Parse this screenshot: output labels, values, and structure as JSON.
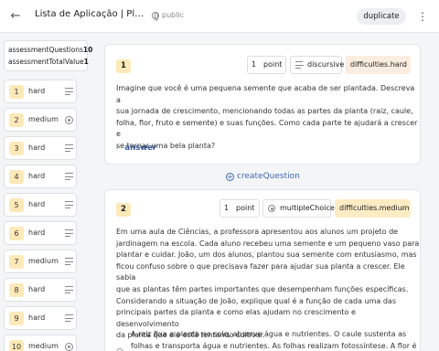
{
  "header": {
    "title": "Lista de Aplicação | Plantas...",
    "visibility": "public",
    "duplicate_label": "duplicate"
  },
  "assessment": {
    "questions_label": "assessmentQuestions",
    "questions_value": "10",
    "total_label": "assessmentTotalValue",
    "total_value": "1"
  },
  "sidebar": {
    "items": [
      {
        "num": "1",
        "difficulty": "hard",
        "type": "discursive"
      },
      {
        "num": "2",
        "difficulty": "medium",
        "type": "multipleChoice"
      },
      {
        "num": "3",
        "difficulty": "hard",
        "type": "discursive"
      },
      {
        "num": "4",
        "difficulty": "hard",
        "type": "discursive"
      },
      {
        "num": "5",
        "difficulty": "hard",
        "type": "discursive"
      },
      {
        "num": "6",
        "difficulty": "hard",
        "type": "discursive"
      },
      {
        "num": "7",
        "difficulty": "medium",
        "type": "discursive"
      },
      {
        "num": "8",
        "difficulty": "hard",
        "type": "discursive"
      },
      {
        "num": "9",
        "difficulty": "hard",
        "type": "discursive"
      },
      {
        "num": "10",
        "difficulty": "medium",
        "type": "multipleChoice"
      }
    ]
  },
  "questions": [
    {
      "num": "1",
      "points": "1",
      "points_unit": "point",
      "type": "discursive",
      "difficulty": "difficulties.hard",
      "text_lines": [
        "Imagine que você é uma pequena semente que acaba de ser plantada. Descreva a",
        "sua jornada de crescimento, mencionando todas as partes da planta (raiz, caule,",
        "folha, flor, fruto e semente) e suas funções. Como cada parte te ajudará a crescer e",
        "se tornar uma bela planta?"
      ],
      "answer_label": "answer"
    },
    {
      "num": "2",
      "points": "1",
      "points_unit": "point",
      "type": "multipleChoice",
      "difficulty": "difficulties.medium",
      "text_lines": [
        "Em uma aula de Ciências, a professora apresentou aos alunos um projeto de",
        "jardinagem na escola. Cada aluno recebeu uma semente e um pequeno vaso para",
        "plantar e cuidar. João, um dos alunos, plantou sua semente com entusiasmo, mas",
        "ficou confuso sobre o que precisava fazer para ajudar sua planta a crescer. Ele sabia",
        "que as plantas têm partes importantes que desempenham funções específicas.",
        "Considerando a situação de João, explique qual é a função de cada uma das",
        "principais partes da planta e como elas ajudam no crescimento e desenvolvimento",
        "da planta que ele está tentando cultivar."
      ],
      "option_lines": [
        "A raiz fixa a planta no solo, absorve água e nutrientes. O caule sustenta as",
        "folhas e transporta água e nutrientes. As folhas realizam fotossíntese. A flor é"
      ]
    }
  ],
  "create_question_label": "createQuestion"
}
